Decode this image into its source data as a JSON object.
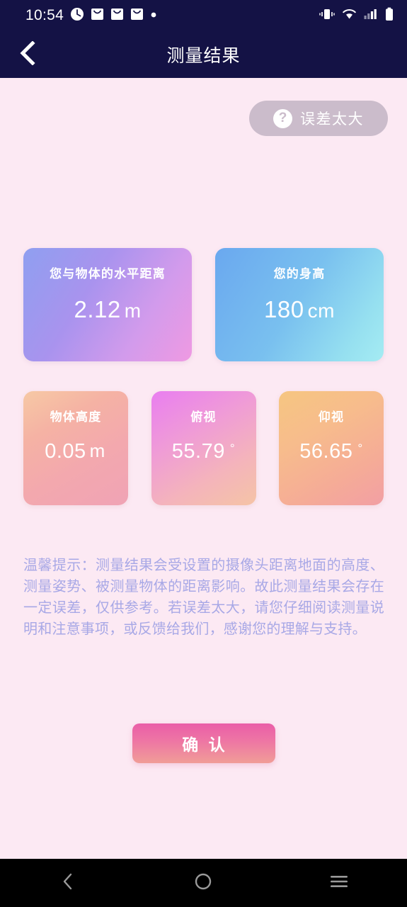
{
  "statusbar": {
    "time": "10:54",
    "icons_left": [
      "clock-icon",
      "mail-icon",
      "mail-icon",
      "mail-icon",
      "dot-icon"
    ],
    "icons_right": [
      "vibrate-icon",
      "wifi-icon",
      "signal-icon",
      "battery-icon"
    ]
  },
  "header": {
    "title": "测量结果",
    "back_icon": "chevron-left-icon"
  },
  "error_button": {
    "label": "误差太大",
    "icon": "question-mark-icon",
    "background": "#cbbccb"
  },
  "results": {
    "big_cards": [
      {
        "label": "您与物体的水平距离",
        "value": "2.12",
        "unit": "m"
      },
      {
        "label": "您的身高",
        "value": "180",
        "unit": "cm"
      }
    ],
    "small_cards": [
      {
        "label": "物体高度",
        "value": "0.05",
        "unit": "m",
        "degree": ""
      },
      {
        "label": "俯视",
        "value": "55.79",
        "unit": "",
        "degree": "°"
      },
      {
        "label": "仰视",
        "value": "56.65",
        "unit": "",
        "degree": "°"
      }
    ]
  },
  "tips": {
    "text": "温馨提示：测量结果会受设置的摄像头距离地面的高度、测量姿势、被测量物体的距离影响。故此测量结果会存在一定误差，仅供参考。若误差太大，请您仔细阅读测量说明和注意事项，或反馈给我们，感谢您的理解与支持。",
    "color": "#a8a8e6"
  },
  "confirm": {
    "label": "确 认"
  },
  "navbar": {
    "back": "nav-back-icon",
    "home": "nav-home-icon",
    "recents": "nav-recents-icon"
  },
  "theme": {
    "background": "#fce9f3",
    "header_background": "#141245"
  }
}
